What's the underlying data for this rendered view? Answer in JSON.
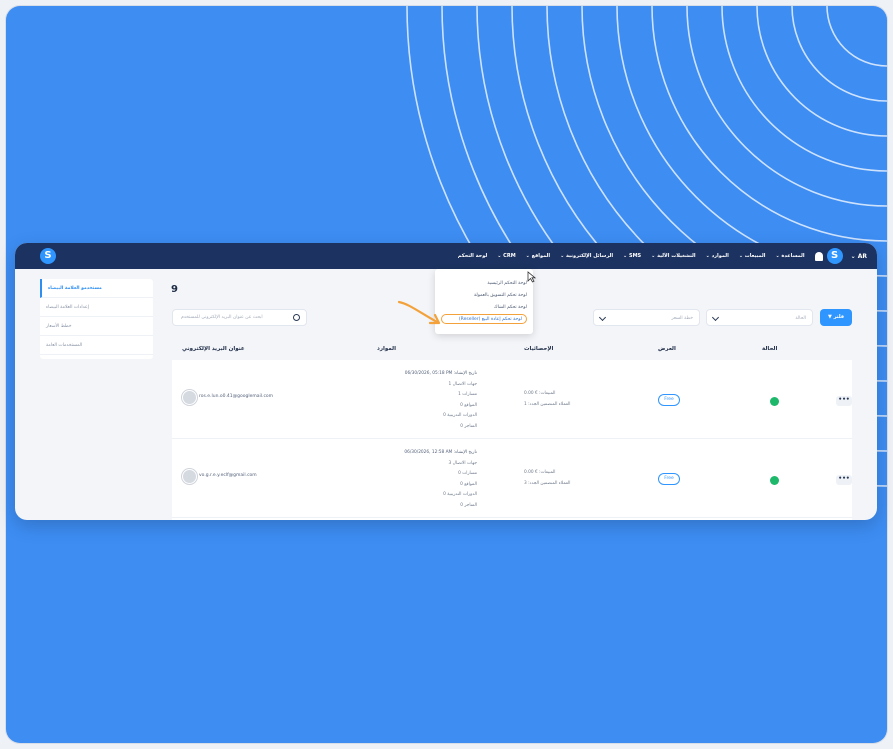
{
  "brand": {
    "logo_letter": "S",
    "accent": "#2f95ff",
    "navbar_bg": "#1c3260",
    "background": "#3d8df3"
  },
  "topbar": {
    "lang": "AR ⌄",
    "avatar_letter": "S",
    "nav": [
      "المساعدة ⌄",
      "المبيعات ⌄",
      "الموارد ⌄",
      "التشغيلات الآلية ⌄",
      "SMS ⌄",
      "الرسائل الإلكترونية ⌄",
      "المواقع ⌄",
      "CRM ⌄",
      "لوحة التحكم"
    ]
  },
  "dropdown": {
    "items": [
      "لوحة التحكم الرئيسية",
      "لوحة تحكم التسويق بالعمولة",
      "لوحة تحكم الشاك",
      "(Reseller) لوحة تحكم إعادة البيع"
    ]
  },
  "sidebar": {
    "items": [
      "مستخدمو العلامة البيضاء",
      "إعدادات العلامة البيضاء",
      "خطط الأسعار",
      "المستخدمات العامة"
    ]
  },
  "main": {
    "count": "9",
    "search_placeholder": "ابحث عن عنوان البريد الإلكتروني للمستخدم",
    "filter_status": "الحالة",
    "filter_plan": "خطة السعر",
    "filter_button": "فلتر"
  },
  "table": {
    "headers": {
      "email": "عنوان البريد الإلكتروني",
      "resources": "الموارد",
      "stats": "الإحصائيات",
      "offer": "العرض",
      "status": "الحالة"
    },
    "rows": [
      {
        "email": "ros.e.lun.o0.41@googlemail.com",
        "created": "06/30/2026, 05:18 PM :تاريخ الإنشاء",
        "contacts": "جهات الاتصال 1",
        "funnels": "مسارات 1",
        "sites": "المواقع 0",
        "courses": "الدورات التدريبية 0",
        "stores": "المتاجر 0",
        "sales": "المبيعات: € 0.00",
        "paying_customers": "العملاء المنضمين الجدد: 1",
        "offer": "Free",
        "actions": "•••"
      },
      {
        "email": "vo.g.r.e.y.eclf@gmail.com",
        "created": "06/30/2026, 12:58 AM :تاريخ الإنشاء",
        "contacts": "جهات الاتصال 3",
        "funnels": "مسارات 0",
        "sites": "المواقع 0",
        "courses": "الدورات التدريبية 0",
        "stores": "المتاجر 0",
        "sales": "المبيعات: € 0.00",
        "paying_customers": "العملاء المنضمين الجدد: 3",
        "offer": "Free",
        "actions": "•••"
      }
    ]
  }
}
